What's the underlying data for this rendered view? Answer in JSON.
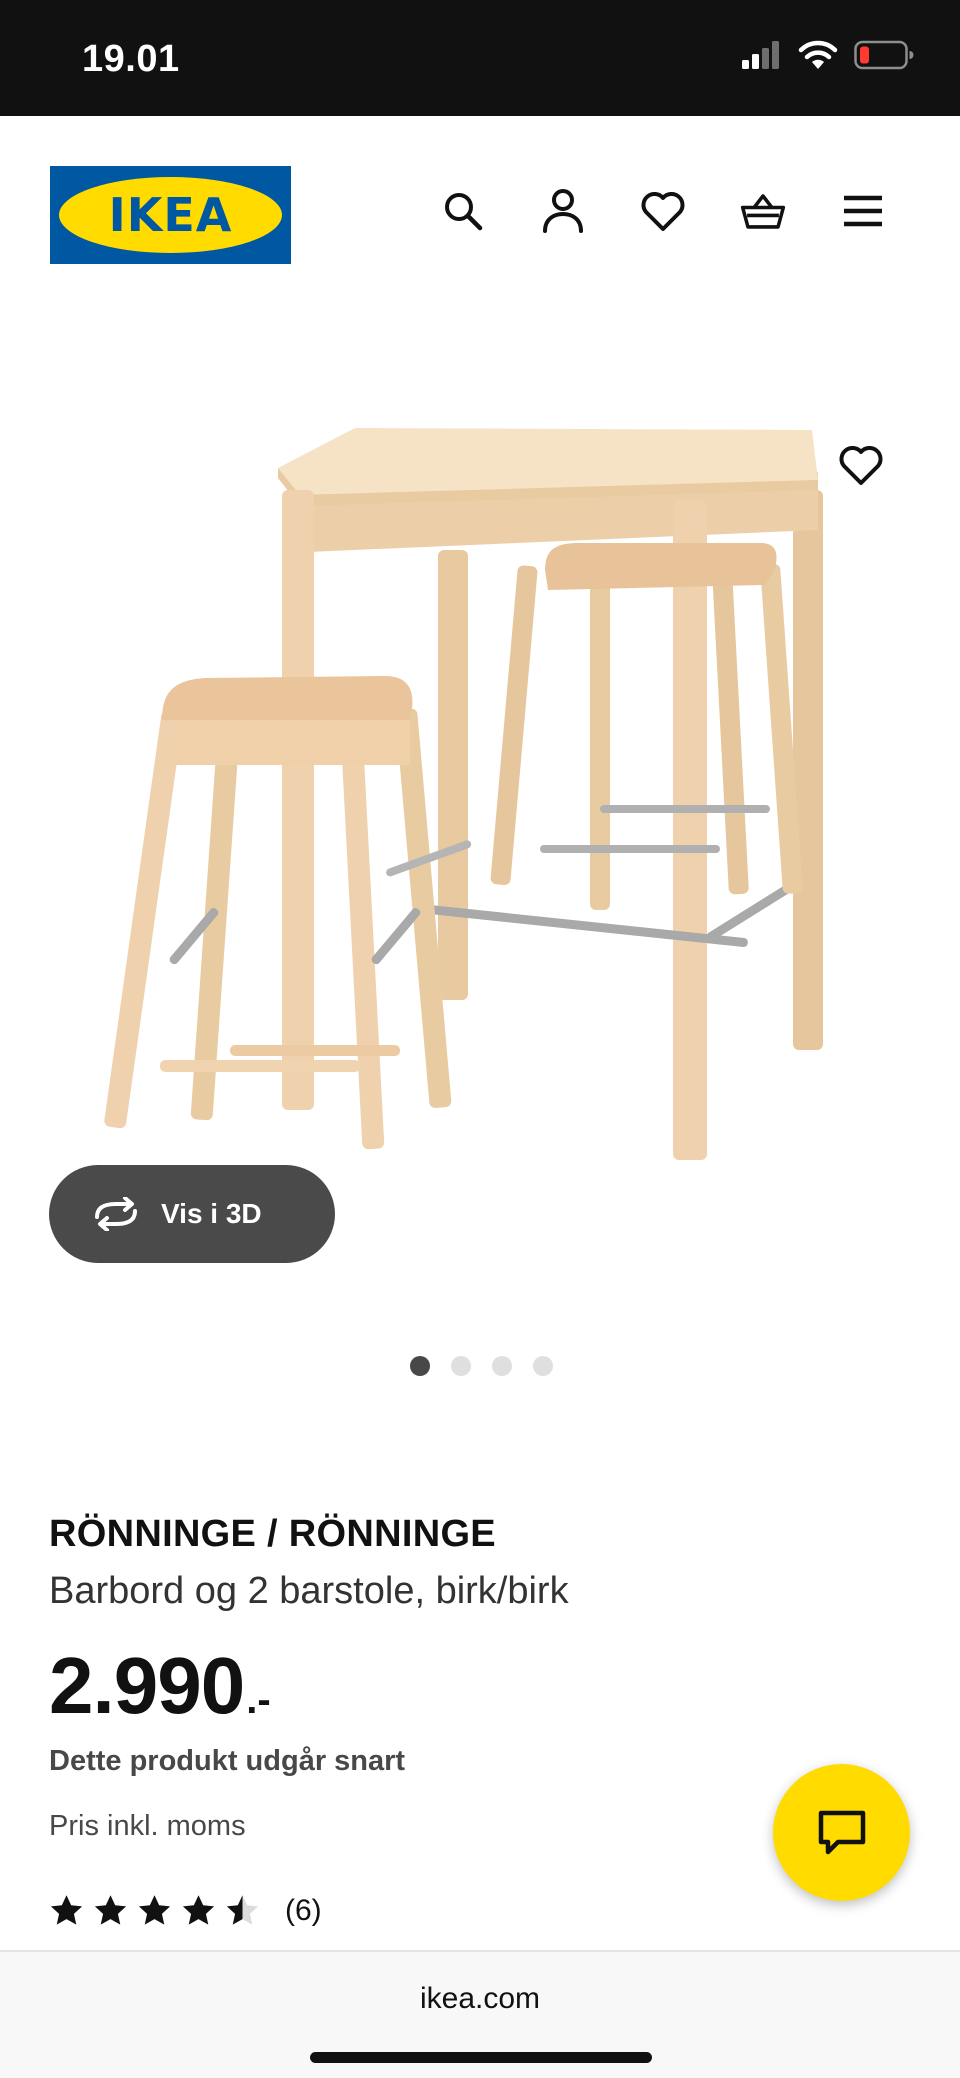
{
  "status_bar": {
    "time": "19.01",
    "icons": [
      "signal-icon",
      "wifi-icon",
      "battery-low-icon"
    ]
  },
  "header": {
    "logo_text": "IKEA",
    "icons": [
      "search-icon",
      "account-icon",
      "favorites-icon",
      "basket-icon",
      "menu-icon"
    ]
  },
  "gallery": {
    "view_3d_label": "Vis i 3D",
    "image_count": 4,
    "active_image": 1
  },
  "product": {
    "name": "RÖNNINGE / RÖNNINGE",
    "description": "Barbord og 2 barstole, birk/birk",
    "price": "2.990",
    "price_suffix": ".-",
    "discontinued_note": "Dette produkt udgår snart",
    "vat_note": "Pris inkl. moms",
    "rating": 4.5,
    "rating_max": 5,
    "review_count": "(6)"
  },
  "browser": {
    "url": "ikea.com"
  },
  "colors": {
    "ikea_blue": "#0058a3",
    "ikea_yellow": "#ffdb00",
    "battery_red": "#ff3b30",
    "wood": "#efd2ad"
  }
}
